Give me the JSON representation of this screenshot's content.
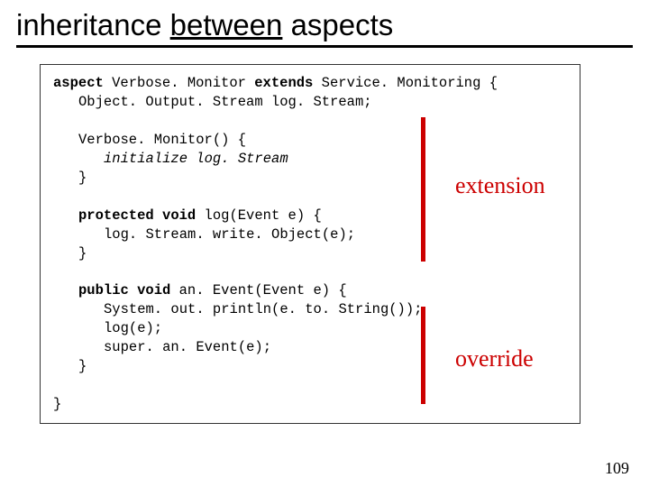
{
  "title": {
    "word1": "inheritance",
    "word2": "between",
    "word3": "aspects"
  },
  "code": {
    "l1a": "aspect",
    "l1b": " Verbose. Monitor ",
    "l1c": "extends",
    "l1d": " Service. Monitoring {",
    "l2": "Object. Output. Stream log. Stream;",
    "l3": "Verbose. Monitor() {",
    "l4a": "initialize log. Stream",
    "l5": "}",
    "l6a": "protected void",
    "l6b": " log(Event e) {",
    "l7": "log. Stream. write. Object(e);",
    "l8": "}",
    "l9a": "public void",
    "l9b": " an. Event(Event e) {",
    "l10": "System. out. println(e. to. String());",
    "l11": "log(e);",
    "l12": "super. an. Event(e);",
    "l13": "}",
    "l14": "}"
  },
  "annotations": {
    "extension": "extension",
    "override": "override"
  },
  "page": "109"
}
